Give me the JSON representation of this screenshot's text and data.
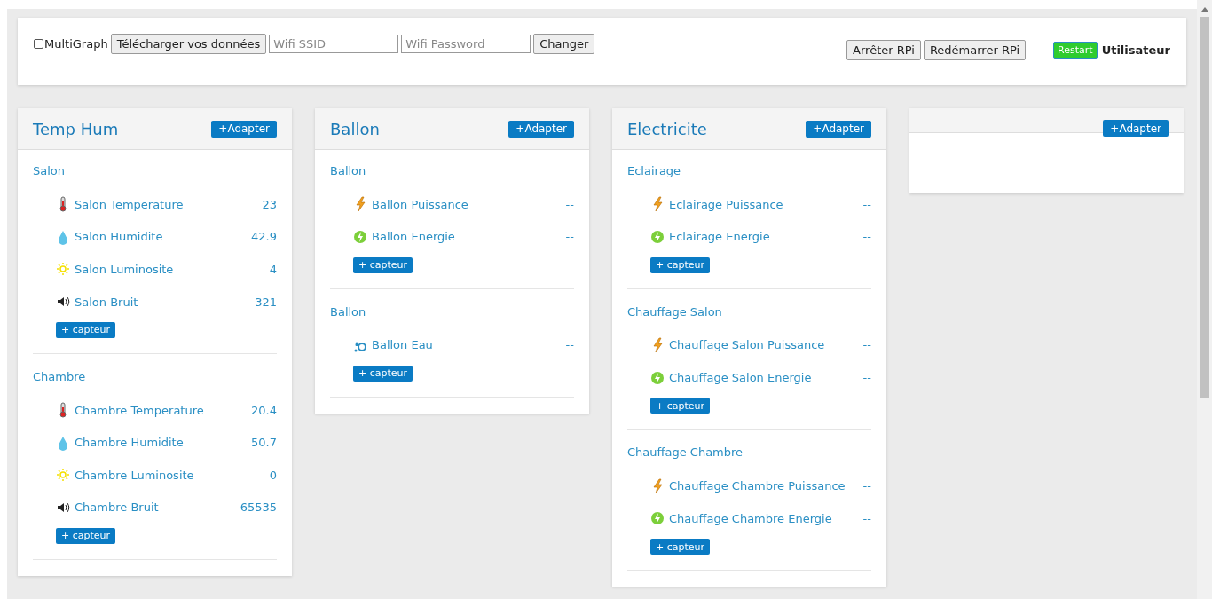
{
  "toolbar": {
    "multigraph": {
      "label": "MultiGraph",
      "checked": false
    },
    "download_button": "Télécharger vos données",
    "ssid_field": {
      "placeholder": "Wifi SSID"
    },
    "password_field": {
      "placeholder": "Wifi Password"
    },
    "change_button": "Changer",
    "stop_button": "Arrêter RPi",
    "reboot_button": "Redémarrer RPi",
    "restart_button": "Restart",
    "user": "Utilisateur"
  },
  "panels": [
    {
      "title": "Temp Hum",
      "add_button": "+Adapter",
      "groups": [
        {
          "name": "Salon",
          "add_button": "+ capteur",
          "sensors": [
            {
              "kind": "temperature",
              "name": "Salon Temperature",
              "value": "23"
            },
            {
              "kind": "humidity",
              "name": "Salon Humidite",
              "value": "42.9"
            },
            {
              "kind": "light",
              "name": "Salon Luminosite",
              "value": "4"
            },
            {
              "kind": "noise",
              "name": "Salon Bruit",
              "value": "321"
            }
          ]
        },
        {
          "name": "Chambre",
          "add_button": "+ capteur",
          "sensors": [
            {
              "kind": "temperature",
              "name": "Chambre Temperature",
              "value": "20.4"
            },
            {
              "kind": "humidity",
              "name": "Chambre Humidite",
              "value": "50.7"
            },
            {
              "kind": "light",
              "name": "Chambre Luminosite",
              "value": "0"
            },
            {
              "kind": "noise",
              "name": "Chambre Bruit",
              "value": "65535"
            }
          ]
        }
      ]
    },
    {
      "title": "Ballon",
      "add_button": "+Adapter",
      "groups": [
        {
          "name": "Ballon",
          "add_button": "+ capteur",
          "sensors": [
            {
              "kind": "power",
              "name": "Ballon Puissance",
              "value": "--"
            },
            {
              "kind": "energy",
              "name": "Ballon Energie",
              "value": "--"
            }
          ]
        },
        {
          "name": "Ballon",
          "add_button": "+ capteur",
          "sensors": [
            {
              "kind": "water",
              "name": "Ballon Eau",
              "value": "--"
            }
          ]
        }
      ]
    },
    {
      "title": "Electricite",
      "add_button": "+Adapter",
      "groups": [
        {
          "name": "Eclairage",
          "add_button": "+ capteur",
          "sensors": [
            {
              "kind": "power",
              "name": "Eclairage Puissance",
              "value": "--"
            },
            {
              "kind": "energy",
              "name": "Eclairage Energie",
              "value": "--"
            }
          ]
        },
        {
          "name": "Chauffage Salon",
          "add_button": "+ capteur",
          "sensors": [
            {
              "kind": "power",
              "name": "Chauffage Salon Puissance",
              "value": "--"
            },
            {
              "kind": "energy",
              "name": "Chauffage Salon Energie",
              "value": "--"
            }
          ]
        },
        {
          "name": "Chauffage Chambre",
          "add_button": "+ capteur",
          "sensors": [
            {
              "kind": "power",
              "name": "Chauffage Chambre Puissance",
              "value": "--"
            },
            {
              "kind": "energy",
              "name": "Chauffage Chambre Energie",
              "value": "--"
            }
          ]
        }
      ]
    },
    {
      "add_button": "+Adapter"
    }
  ]
}
